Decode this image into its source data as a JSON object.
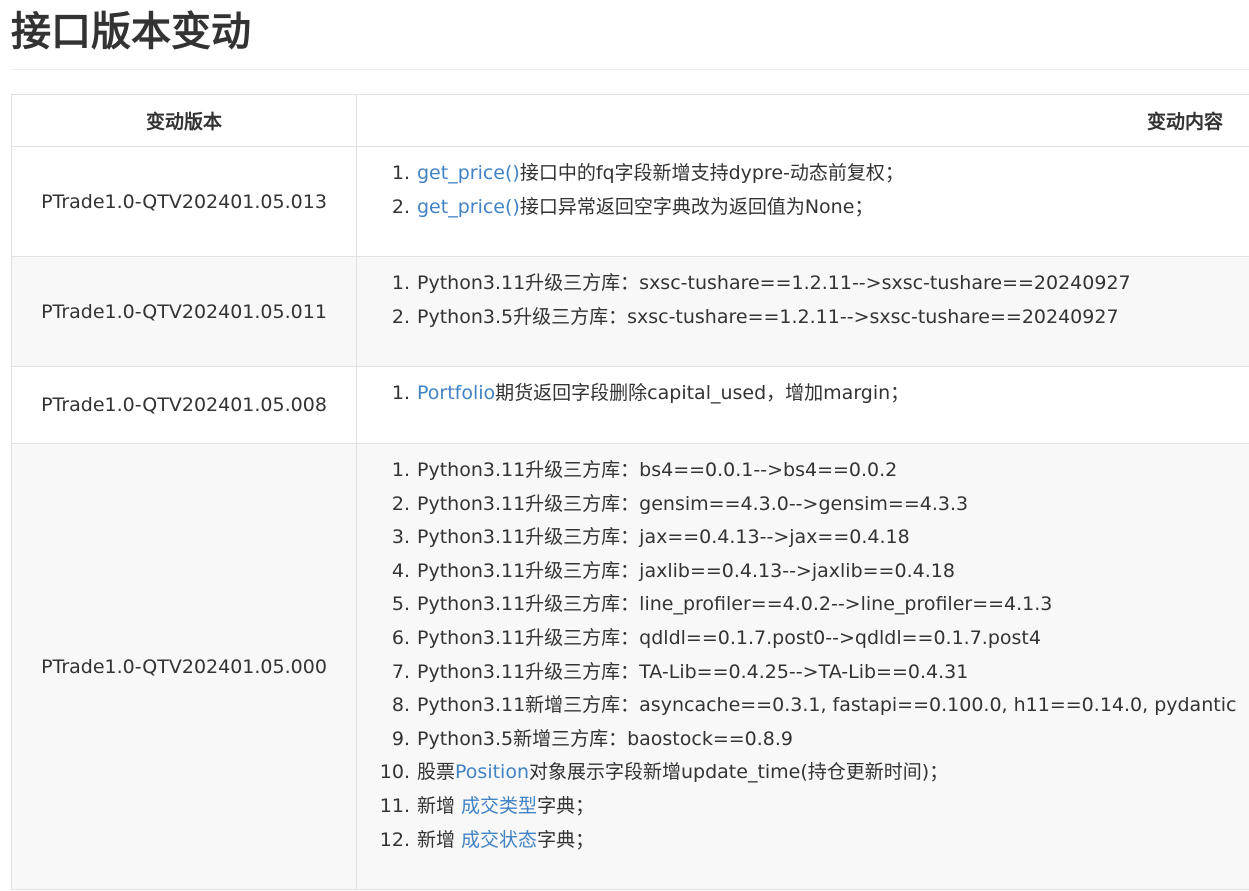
{
  "page": {
    "title": "接口版本变动"
  },
  "table": {
    "headers": {
      "version": "变动版本",
      "content": "变动内容"
    },
    "rows": [
      {
        "version": "PTrade1.0-QTV202401.05.013",
        "items": [
          {
            "num": "1.",
            "before": "",
            "link": "get_price()",
            "after": "接口中的fq字段新增支持dypre-动态前复权；"
          },
          {
            "num": "2.",
            "before": "",
            "link": "get_price()",
            "after": "接口异常返回空字典改为返回值为None；"
          }
        ]
      },
      {
        "version": "PTrade1.0-QTV202401.05.011",
        "items": [
          {
            "num": "1.",
            "before": "Python3.11升级三方库：sxsc-tushare==1.2.11-->sxsc-tushare==20240927",
            "link": "",
            "after": ""
          },
          {
            "num": "2.",
            "before": "Python3.5升级三方库：sxsc-tushare==1.2.11-->sxsc-tushare==20240927",
            "link": "",
            "after": ""
          }
        ]
      },
      {
        "version": "PTrade1.0-QTV202401.05.008",
        "items": [
          {
            "num": "1.",
            "before": "",
            "link": "Portfolio",
            "after": "期货返回字段删除capital_used，增加margin；"
          }
        ]
      },
      {
        "version": "PTrade1.0-QTV202401.05.000",
        "items": [
          {
            "num": "1.",
            "before": "Python3.11升级三方库：bs4==0.0.1-->bs4==0.0.2",
            "link": "",
            "after": ""
          },
          {
            "num": "2.",
            "before": "Python3.11升级三方库：gensim==4.3.0-->gensim==4.3.3",
            "link": "",
            "after": ""
          },
          {
            "num": "3.",
            "before": "Python3.11升级三方库：jax==0.4.13-->jax==0.4.18",
            "link": "",
            "after": ""
          },
          {
            "num": "4.",
            "before": "Python3.11升级三方库：jaxlib==0.4.13-->jaxlib==0.4.18",
            "link": "",
            "after": ""
          },
          {
            "num": "5.",
            "before": "Python3.11升级三方库：line_profiler==4.0.2-->line_profiler==4.1.3",
            "link": "",
            "after": ""
          },
          {
            "num": "6.",
            "before": "Python3.11升级三方库：qdldl==0.1.7.post0-->qdldl==0.1.7.post4",
            "link": "",
            "after": ""
          },
          {
            "num": "7.",
            "before": "Python3.11升级三方库：TA-Lib==0.4.25-->TA-Lib==0.4.31",
            "link": "",
            "after": ""
          },
          {
            "num": "8.",
            "before": "Python3.11新增三方库：asyncache==0.3.1, fastapi==0.100.0, h11==0.14.0, pydantic",
            "link": "",
            "after": ""
          },
          {
            "num": "9.",
            "before": "Python3.5新增三方库：baostock==0.8.9",
            "link": "",
            "after": ""
          },
          {
            "num": "10.",
            "before": "股票",
            "link": "Position",
            "after": "对象展示字段新增update_time(持仓更新时间)；"
          },
          {
            "num": "11.",
            "before": "新增 ",
            "link": "成交类型",
            "after": "字典；"
          },
          {
            "num": "12.",
            "before": "新增 ",
            "link": "成交状态",
            "after": "字典；"
          }
        ]
      }
    ]
  }
}
